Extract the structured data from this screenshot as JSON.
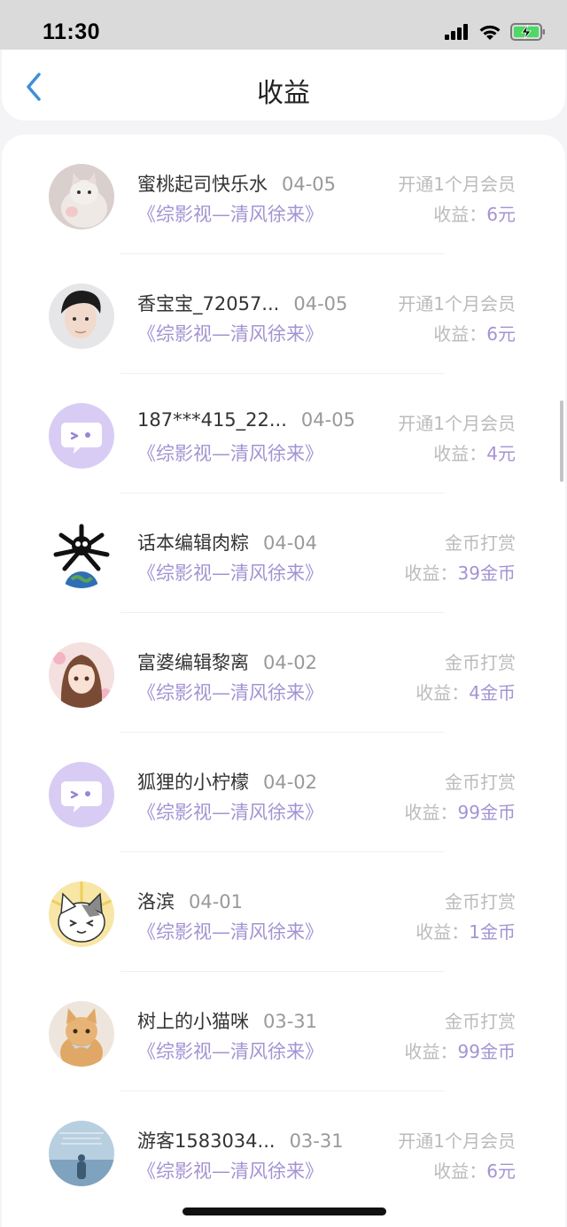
{
  "status_bar": {
    "time": "11:30",
    "icons": [
      "cellular-signal-icon",
      "wifi-icon",
      "battery-charging-icon"
    ]
  },
  "header": {
    "back_icon": "chevron-left-icon",
    "title": "收益"
  },
  "colors": {
    "accent": "#a493d2",
    "back_blue": "#3d8fdb",
    "muted": "#bbbbbb"
  },
  "earnings": [
    {
      "name": "蜜桃起司快乐水",
      "date": "04-05",
      "work": "《综影视—清风徐来》",
      "type": "开通1个月会员",
      "label": "收益：",
      "amount": "6元",
      "avatar": "cat-photo-avatar"
    },
    {
      "name": "香宝宝_72057...",
      "date": "04-05",
      "work": "《综影视—清风徐来》",
      "type": "开通1个月会员",
      "label": "收益：",
      "amount": "6元",
      "avatar": "young-man-photo-avatar"
    },
    {
      "name": "187***415_22...",
      "date": "04-05",
      "work": "《综影视—清风徐来》",
      "type": "开通1个月会员",
      "label": "收益：",
      "amount": "4元",
      "avatar": "default-chat-bubble-avatar"
    },
    {
      "name": "话本编辑肉粽",
      "date": "04-04",
      "work": "《综影视—清风徐来》",
      "type": "金币打赏",
      "label": "收益：",
      "amount": "39金币",
      "avatar": "earth-figure-avatar"
    },
    {
      "name": "富婆编辑黎离",
      "date": "04-02",
      "work": "《综影视—清风徐来》",
      "type": "金币打赏",
      "label": "收益：",
      "amount": "4金币",
      "avatar": "anime-girl-avatar"
    },
    {
      "name": "狐狸的小柠檬",
      "date": "04-02",
      "work": "《综影视—清风徐来》",
      "type": "金币打赏",
      "label": "收益：",
      "amount": "99金币",
      "avatar": "default-chat-bubble-avatar"
    },
    {
      "name": "洛滨",
      "date": "04-01",
      "work": "《综影视—清风徐来》",
      "type": "金币打赏",
      "label": "收益：",
      "amount": "1金币",
      "avatar": "cartoon-cat-avatar"
    },
    {
      "name": "树上的小猫咪",
      "date": "03-31",
      "work": "《综影视—清风徐来》",
      "type": "金币打赏",
      "label": "收益：",
      "amount": "99金币",
      "avatar": "orange-kitten-avatar"
    },
    {
      "name": "游客1583034...",
      "date": "03-31",
      "work": "《综影视—清风徐来》",
      "type": "开通1个月会员",
      "label": "收益：",
      "amount": "6元",
      "avatar": "blue-scenery-avatar"
    }
  ]
}
